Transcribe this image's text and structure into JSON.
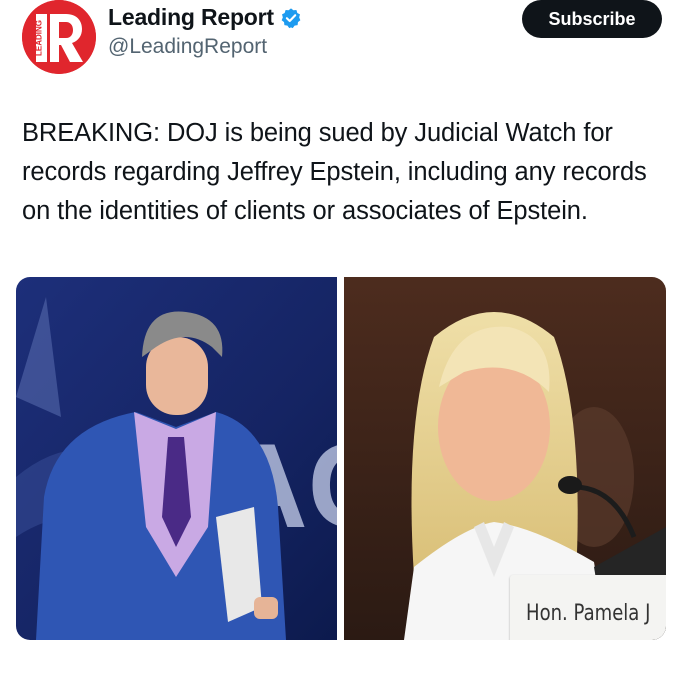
{
  "author": {
    "display_name": "Leading Report",
    "handle": "@LeadingReport",
    "verified": true,
    "avatar_icon": "leading-report-logo",
    "avatar_color": "#e0262d"
  },
  "subscribe_label": "Subscribe",
  "tweet_text": "BREAKING: DOJ is being sued by Judicial Watch for records regarding Jeffrey Epstein, including any records on the identities of clients or associates of Epstein.",
  "media": {
    "right_photo_nameplate": "Hon. Pamela J"
  },
  "colors": {
    "verified_badge": "#1d9bf0",
    "button_bg": "#0f1419",
    "handle_gray": "#536471"
  }
}
